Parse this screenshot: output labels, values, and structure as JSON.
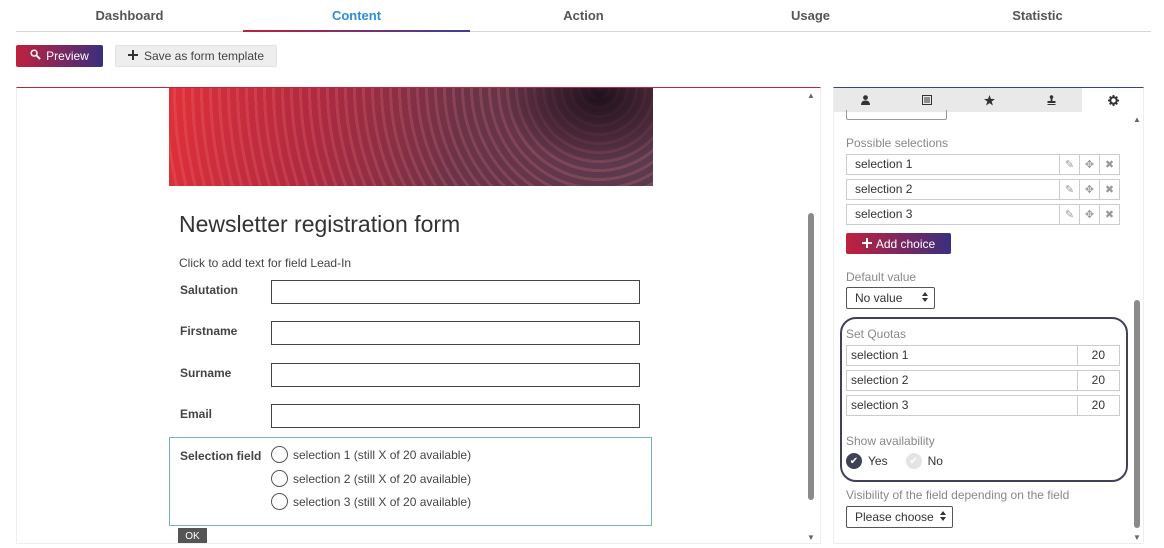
{
  "tabs": [
    {
      "label": "Dashboard",
      "active": false
    },
    {
      "label": "Content",
      "active": true
    },
    {
      "label": "Action",
      "active": false
    },
    {
      "label": "Usage",
      "active": false
    },
    {
      "label": "Statistic",
      "active": false
    }
  ],
  "toolbar": {
    "preview_label": "Preview",
    "preview_icon": "search-icon",
    "template_label": "Save as form template",
    "template_icon": "plus-icon"
  },
  "form": {
    "title": "Newsletter registration form",
    "lead_in": "Click to add text for field Lead-In",
    "fields": [
      {
        "label": "Salutation",
        "value": ""
      },
      {
        "label": "Firstname",
        "value": ""
      },
      {
        "label": "Surname",
        "value": ""
      },
      {
        "label": "Email",
        "value": ""
      }
    ],
    "selection_field": {
      "label": "Selection field",
      "options": [
        "selection 1 (still X of 20 available)",
        "selection 2 (still X of 20 available)",
        "selection 3 (still X of 20 available)"
      ]
    },
    "submit_label": "OK"
  },
  "panel": {
    "tab_icons": [
      "user-icon",
      "list-icon",
      "star-icon",
      "stamp-icon",
      "gear-icon"
    ],
    "active_tab": "gear-icon",
    "possible_selections_label": "Possible selections",
    "choices": [
      "selection 1",
      "selection 2",
      "selection 3"
    ],
    "choice_actions": [
      "pencil-icon",
      "move-icon",
      "close-icon"
    ],
    "add_choice_label": "Add choice",
    "default_value_label": "Default value",
    "default_value": "No value",
    "set_quotas_label": "Set Quotas",
    "quotas": [
      {
        "name": "selection 1",
        "value": "20"
      },
      {
        "name": "selection 2",
        "value": "20"
      },
      {
        "name": "selection 3",
        "value": "20"
      }
    ],
    "show_availability_label": "Show availability",
    "availability_yes": "Yes",
    "availability_no": "No",
    "availability_selected": "Yes",
    "visibility_label": "Visibility of the field depending on the field",
    "visibility_value": "Please choose"
  },
  "colors": {
    "accent_red": "#c0213d",
    "accent_navy": "#3a2f7e",
    "active_tab_text": "#2a8fd6",
    "quota_frame": "#3f4256"
  }
}
